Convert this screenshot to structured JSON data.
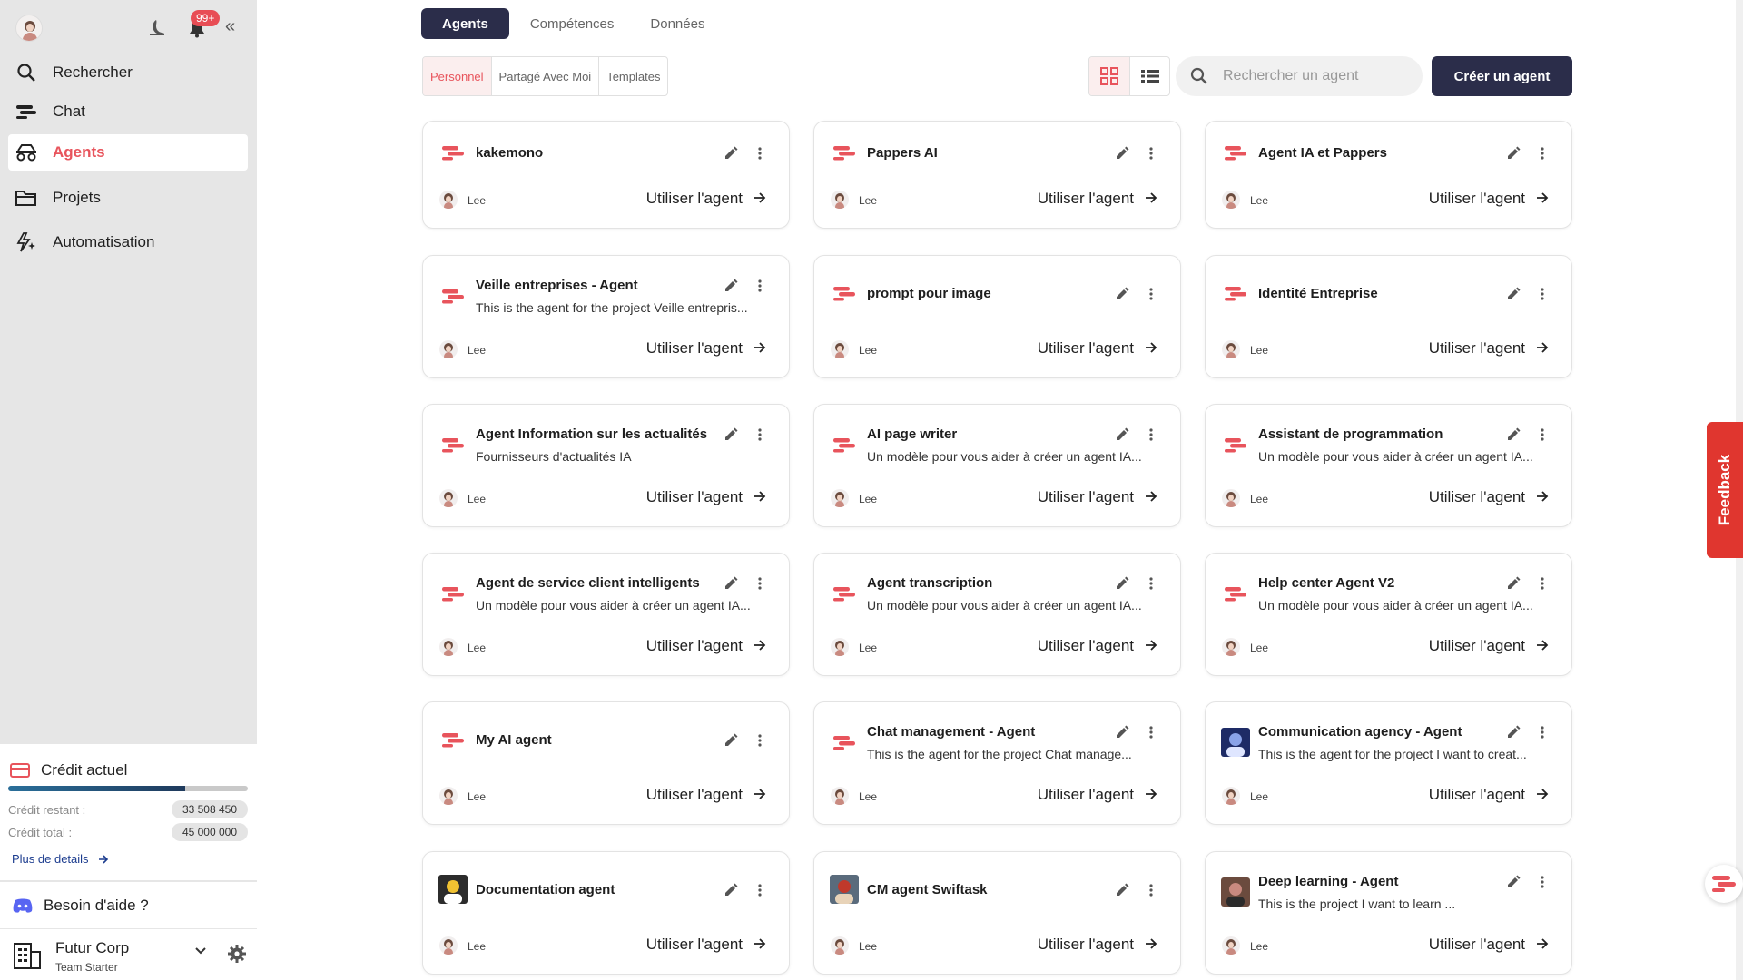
{
  "colors": {
    "accent": "#e8545c",
    "primary_dark": "#2b2d4a",
    "feedback": "#e0362f",
    "link": "#1d3d8f"
  },
  "sidebar": {
    "notifications_badge": "99+",
    "nav": [
      {
        "label": "Rechercher",
        "icon": "search-icon",
        "active": false
      },
      {
        "label": "Chat",
        "icon": "chat-logo-icon",
        "active": false
      },
      {
        "label": "Agents",
        "icon": "agents-icon",
        "active": true
      },
      {
        "label": "Projets",
        "icon": "folder-icon",
        "active": false
      },
      {
        "label": "Automatisation",
        "icon": "automation-icon",
        "active": false
      }
    ],
    "credit": {
      "title": "Crédit actuel",
      "remaining_label": "Crédit restant :",
      "remaining_value": "33 508 450",
      "total_label": "Crédit total :",
      "total_value": "45 000 000",
      "usage_fraction": 0.74,
      "details_link": "Plus de details"
    },
    "help_label": "Besoin d'aide ?",
    "org": {
      "name": "Futur Corp",
      "plan": "Team Starter"
    }
  },
  "main": {
    "tabs": [
      "Agents",
      "Compétences",
      "Données"
    ],
    "active_tab": 0,
    "filters": [
      "Personnel",
      "Partagé Avec Moi",
      "Templates"
    ],
    "active_filter": 0,
    "search_placeholder": "Rechercher un agent",
    "create_button": "Créer un agent"
  },
  "agents": [
    {
      "title": "kakemono",
      "desc": "",
      "owner": "Lee",
      "cta": "Utiliser l'agent",
      "icon": "swiftask-logo-icon"
    },
    {
      "title": "Pappers AI",
      "desc": "",
      "owner": "Lee",
      "cta": "Utiliser l'agent",
      "icon": "swiftask-logo-icon"
    },
    {
      "title": "Agent IA et Pappers",
      "desc": "",
      "owner": "Lee",
      "cta": "Utiliser l'agent",
      "icon": "swiftask-logo-icon"
    },
    {
      "title": "Veille entreprises - Agent",
      "desc": "This is the agent for the project Veille entrepris...",
      "owner": "Lee",
      "cta": "Utiliser l'agent",
      "icon": "swiftask-logo-icon"
    },
    {
      "title": "prompt pour image",
      "desc": "",
      "owner": "Lee",
      "cta": "Utiliser l'agent",
      "icon": "swiftask-logo-icon"
    },
    {
      "title": "Identité Entreprise",
      "desc": "",
      "owner": "Lee",
      "cta": "Utiliser l'agent",
      "icon": "swiftask-logo-icon"
    },
    {
      "title": "Agent Information sur les actualités",
      "desc": "Fournisseurs d'actualités IA",
      "owner": "Lee",
      "cta": "Utiliser l'agent",
      "icon": "swiftask-logo-icon"
    },
    {
      "title": "AI page writer",
      "desc": "Un modèle pour vous aider à créer un agent IA...",
      "owner": "Lee",
      "cta": "Utiliser l'agent",
      "icon": "swiftask-logo-icon"
    },
    {
      "title": "Assistant de programmation",
      "desc": "Un modèle pour vous aider à créer un agent IA...",
      "owner": "Lee",
      "cta": "Utiliser l'agent",
      "icon": "swiftask-logo-icon"
    },
    {
      "title": "Agent de service client intelligents",
      "desc": "Un modèle pour vous aider à créer un agent IA...",
      "owner": "Lee",
      "cta": "Utiliser l'agent",
      "icon": "swiftask-logo-icon"
    },
    {
      "title": "Agent transcription",
      "desc": "Un modèle pour vous aider à créer un agent IA...",
      "owner": "Lee",
      "cta": "Utiliser l'agent",
      "icon": "swiftask-logo-icon"
    },
    {
      "title": "Help center Agent V2",
      "desc": "Un modèle pour vous aider à créer un agent IA...",
      "owner": "Lee",
      "cta": "Utiliser l'agent",
      "icon": "swiftask-logo-icon"
    },
    {
      "title": "My AI agent",
      "desc": "",
      "owner": "Lee",
      "cta": "Utiliser l'agent",
      "icon": "swiftask-logo-icon"
    },
    {
      "title": "Chat management - Agent",
      "desc": "This is the agent for the project Chat manage...",
      "owner": "Lee",
      "cta": "Utiliser l'agent",
      "icon": "swiftask-logo-icon"
    },
    {
      "title": "Communication agency - Agent",
      "desc": "This is the agent for the project I want to creat...",
      "owner": "Lee",
      "cta": "Utiliser l'agent",
      "icon": "agent-image-icon"
    },
    {
      "title": "Documentation agent",
      "desc": "",
      "owner": "Lee",
      "cta": "Utiliser l'agent",
      "icon": "agent-image-icon"
    },
    {
      "title": "CM agent Swiftask",
      "desc": "",
      "owner": "Lee",
      "cta": "Utiliser l'agent",
      "icon": "agent-image-icon"
    },
    {
      "title": "Deep learning - Agent",
      "desc": "This is the project I want to learn ...",
      "owner": "Lee",
      "cta": "Utiliser l'agent",
      "icon": "agent-image-icon"
    }
  ],
  "feedback_label": "Feedback"
}
